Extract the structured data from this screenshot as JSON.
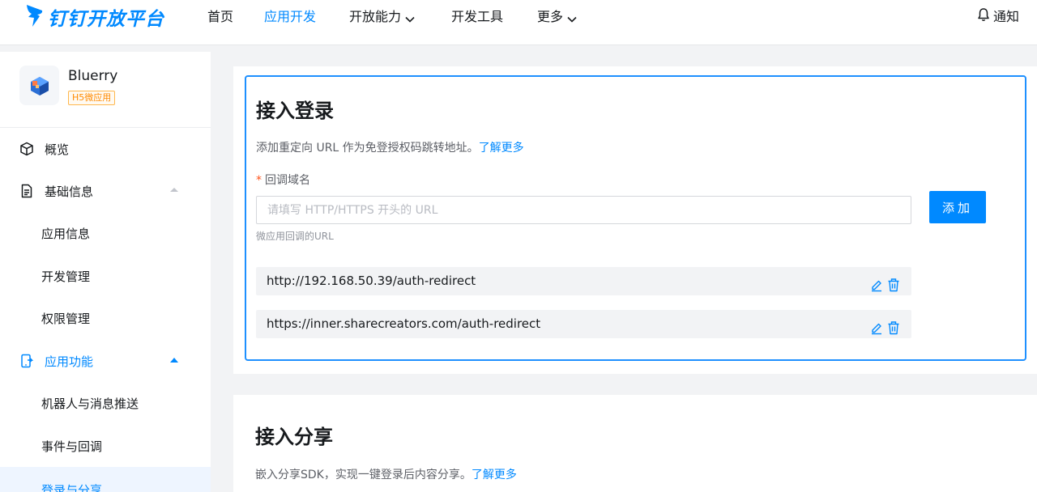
{
  "brand": {
    "name": "钉钉开放平台",
    "color": "#0089ff"
  },
  "nav": {
    "items": [
      {
        "label": "首页"
      },
      {
        "label": "应用开发",
        "active": true
      },
      {
        "label": "开放能力",
        "has_dropdown": true
      },
      {
        "label": "开发工具"
      },
      {
        "label": "更多",
        "has_dropdown": true
      }
    ],
    "notice": {
      "label": "通知",
      "icon": "bell-icon"
    }
  },
  "sidebar": {
    "app": {
      "name": "Bluerry",
      "badge": "H5微应用"
    },
    "items": [
      {
        "label": "概览",
        "icon": "cube-icon"
      },
      {
        "label": "基础信息",
        "icon": "document-icon",
        "expanded": true
      },
      {
        "label": "应用信息"
      },
      {
        "label": "开发管理"
      },
      {
        "label": "权限管理"
      },
      {
        "label": "应用功能",
        "icon": "mobile-share-icon",
        "expanded": true
      },
      {
        "label": "机器人与消息推送"
      },
      {
        "label": "事件与回调"
      },
      {
        "label": "登录与分享",
        "selected": true
      }
    ]
  },
  "login_section": {
    "title": "接入登录",
    "desc": "添加重定向 URL 作为免登授权码跳转地址。",
    "learn_more": "了解更多",
    "field_label": "回调域名",
    "required_mark": "*",
    "input_placeholder": "请填写 HTTP/HTTPS 开头的 URL",
    "input_value": "",
    "hint": "微应用回调的URL",
    "add_button": "添加",
    "urls": [
      {
        "url": "http://192.168.50.39/auth-redirect"
      },
      {
        "url": "https://inner.sharecreators.com/auth-redirect"
      }
    ]
  },
  "share_section": {
    "title": "接入分享",
    "desc": "嵌入分享SDK，实现一键登录后内容分享。",
    "learn_more": "了解更多"
  }
}
